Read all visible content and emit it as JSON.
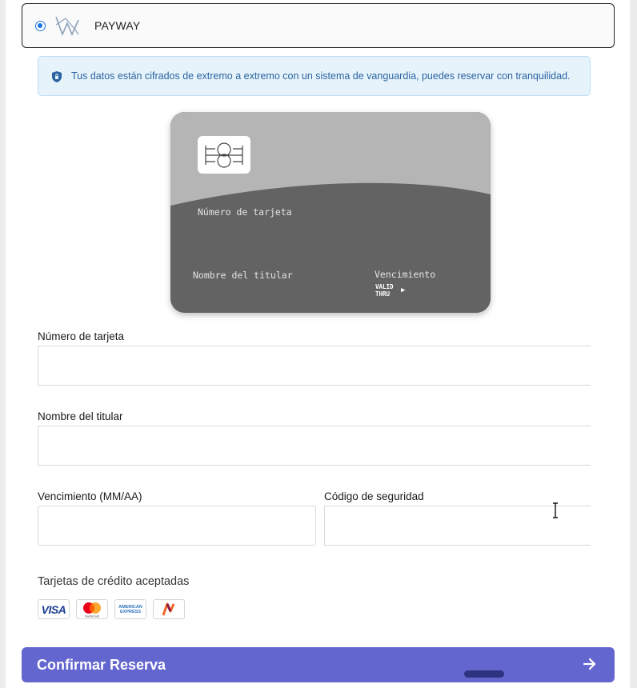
{
  "payment_method": {
    "name": "PAYWAY",
    "selected": true,
    "logo_icon": "payway-logo-icon"
  },
  "security_notice": {
    "icon": "shield-icon",
    "text": "Tus datos están cifrados de extremo a extremo con un sistema de vanguardia, puedes reservar con tranquilidad."
  },
  "card_preview": {
    "number_placeholder": "Número de tarjeta",
    "holder_placeholder": "Nombre del titular",
    "expiry_label": "Vencimiento",
    "valid_thru_line1": "VALID",
    "valid_thru_line2": "THRU",
    "arrow": "▶",
    "colors": {
      "top": "#b5b5b5",
      "bottom": "#636363"
    }
  },
  "form": {
    "card_number_label": "Número de tarjeta",
    "card_number_value": "",
    "holder_label": "Nombre del titular",
    "holder_value": "",
    "expiry_label": "Vencimiento (MM/AA)",
    "expiry_value": "",
    "cvv_label": "Código de seguridad",
    "cvv_value": ""
  },
  "accepted_cards": {
    "title": "Tarjetas de crédito aceptadas",
    "brands": [
      "VISA",
      "mastercard",
      "AMERICAN EXPRESS",
      "Naranja"
    ]
  },
  "confirm_button": {
    "label": "Confirmar Reserva",
    "icon": "arrow-right-icon",
    "color": "#6366cf"
  }
}
